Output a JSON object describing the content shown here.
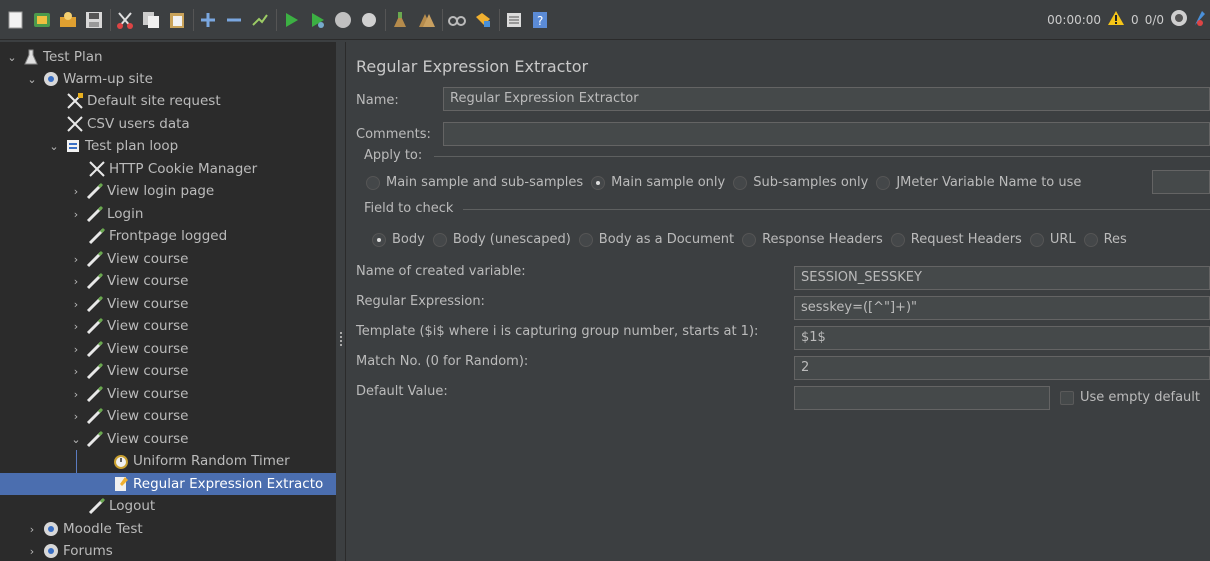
{
  "toolbar": {
    "timer": "00:00:00",
    "warn_count": "0",
    "threads": "0/0"
  },
  "tree": {
    "items": [
      {
        "label": "Test Plan"
      },
      {
        "label": "Warm-up site"
      },
      {
        "label": "Default site request"
      },
      {
        "label": "CSV users data"
      },
      {
        "label": "Test plan loop"
      },
      {
        "label": "HTTP Cookie Manager"
      },
      {
        "label": "View login page"
      },
      {
        "label": "Login"
      },
      {
        "label": "Frontpage logged"
      },
      {
        "label": "View course"
      },
      {
        "label": "View course"
      },
      {
        "label": "View course"
      },
      {
        "label": "View course"
      },
      {
        "label": "View course"
      },
      {
        "label": "View course"
      },
      {
        "label": "View course"
      },
      {
        "label": "View course"
      },
      {
        "label": "Uniform Random Timer"
      },
      {
        "label": "Regular Expression Extracto"
      },
      {
        "label": "Logout"
      },
      {
        "label": "Moodle Test"
      },
      {
        "label": "Forums"
      }
    ]
  },
  "panel": {
    "title": "Regular Expression Extractor",
    "name_label": "Name:",
    "name_value": "Regular Expression Extractor",
    "comments_label": "Comments:",
    "comments_value": "",
    "apply_to_label": "Apply to:",
    "apply_to_options": [
      "Main sample and sub-samples",
      "Main sample only",
      "Sub-samples only",
      "JMeter Variable Name to use"
    ],
    "apply_to_selected": "Main sample only",
    "field_to_check_label": "Field to check",
    "field_options": [
      "Body",
      "Body (unescaped)",
      "Body as a Document",
      "Response Headers",
      "Request Headers",
      "URL",
      "Res"
    ],
    "field_selected": "Body",
    "var_name_label": "Name of created variable:",
    "var_name_value": "SESSION_SESSKEY",
    "regex_label": "Regular Expression:",
    "regex_value": "sesskey=([^\"]+)\"",
    "template_label": "Template ($i$ where i is capturing group number, starts at 1):",
    "template_value": "$1$",
    "match_label": "Match No. (0 for Random):",
    "match_value": "2",
    "default_label": "Default Value:",
    "default_value": "",
    "use_empty_label": "Use empty default"
  },
  "colors": {
    "selection": "#4b6eaf",
    "tree_bg": "#2b2b2b",
    "panel_bg": "#3c3f41"
  }
}
